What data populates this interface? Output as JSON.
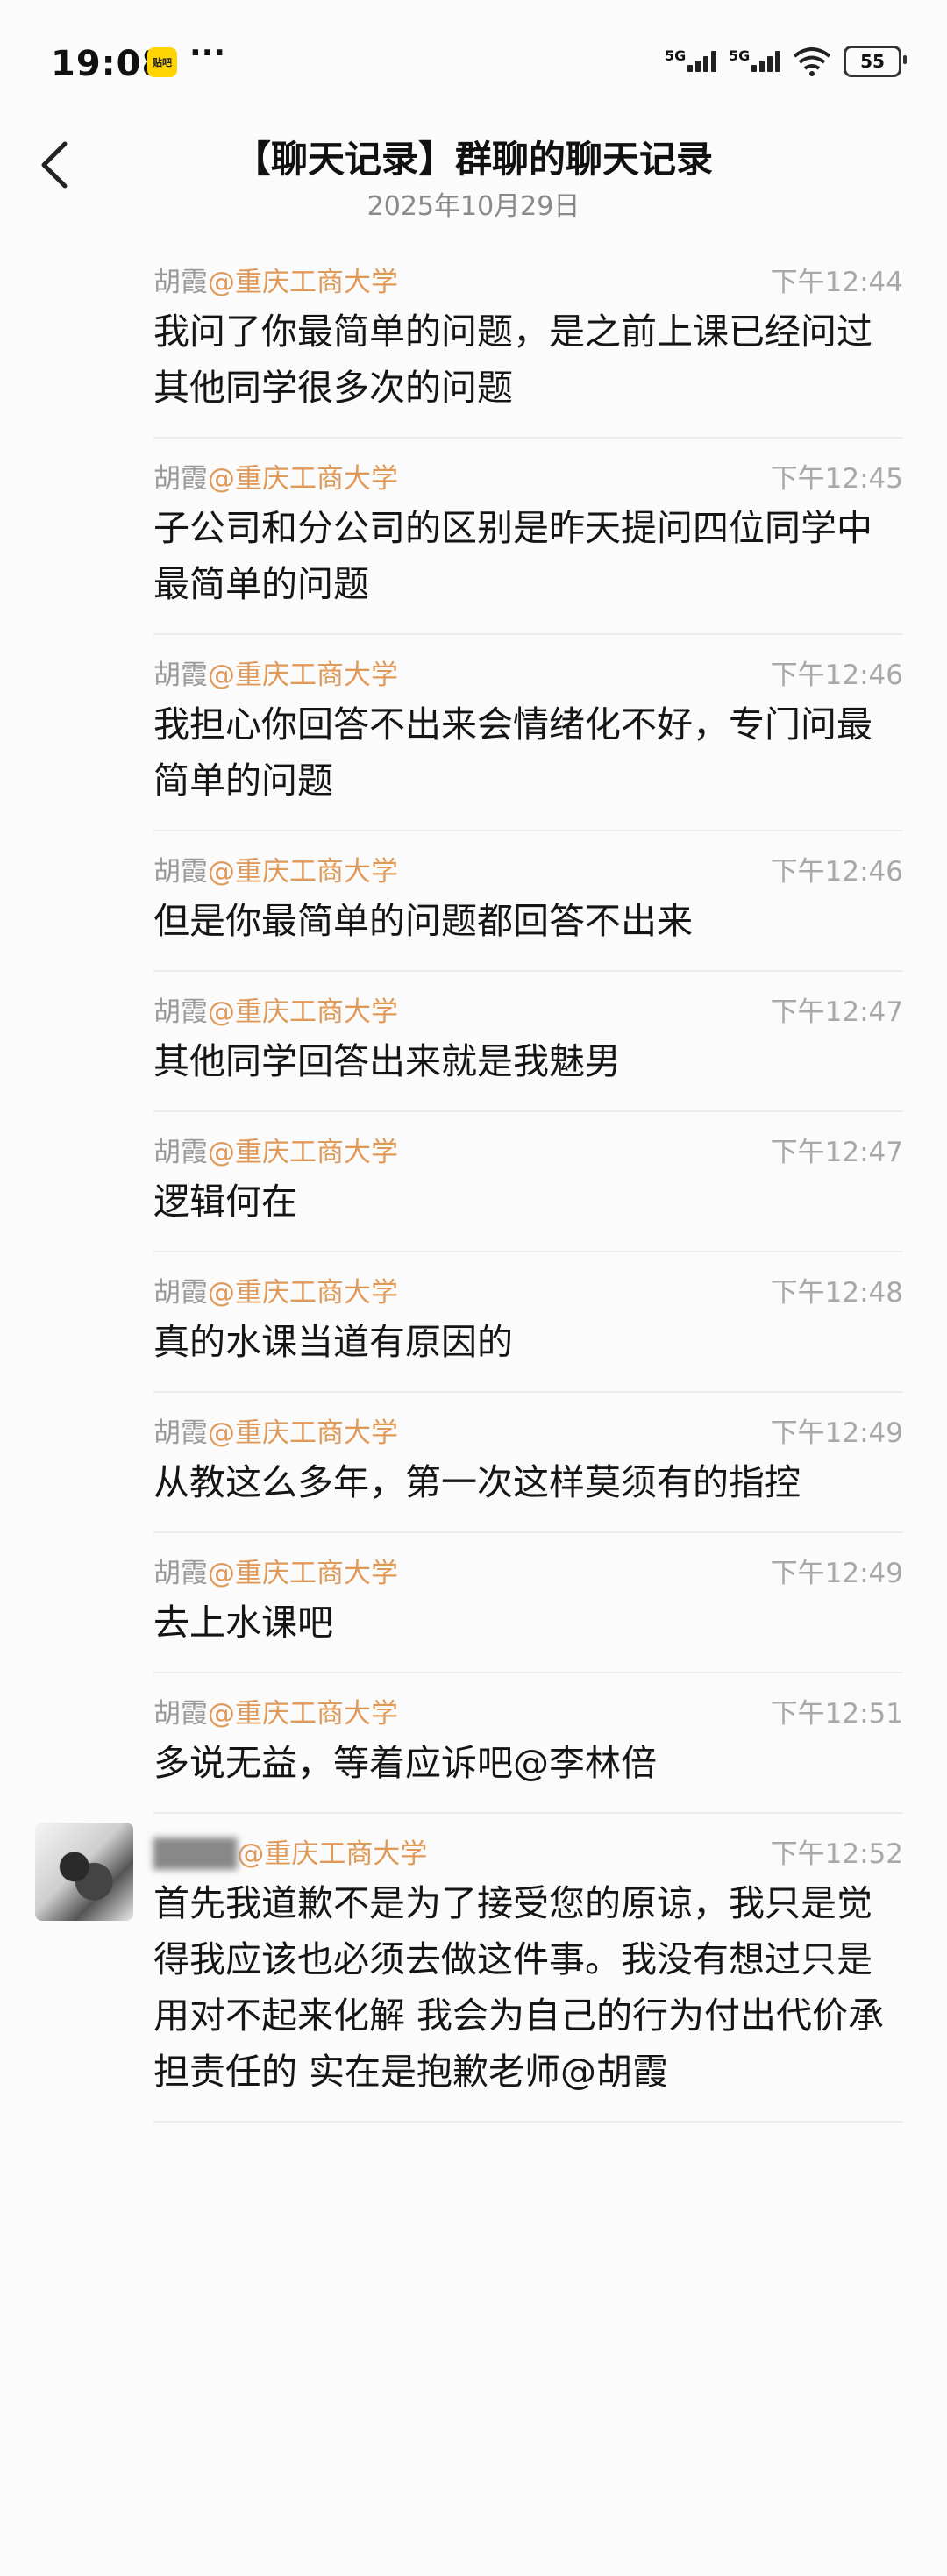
{
  "status": {
    "time": "19:08",
    "app_badge": "贴吧",
    "dots": "···",
    "net1": "5G",
    "net2": "5G",
    "battery": "55"
  },
  "header": {
    "title": "【聊天记录】群聊的聊天记录",
    "date": "2025年10月29日"
  },
  "messages": [
    {
      "name": "胡霞",
      "org": "@重庆工商大学",
      "time": "下午12:44",
      "text": "我问了你最简单的问题，是之前上课已经问过其他同学很多次的问题"
    },
    {
      "name": "胡霞",
      "org": "@重庆工商大学",
      "time": "下午12:45",
      "text": "子公司和分公司的区别是昨天提问四位同学中最简单的问题"
    },
    {
      "name": "胡霞",
      "org": "@重庆工商大学",
      "time": "下午12:46",
      "text": "我担心你回答不出来会情绪化不好，专门问最简单的问题"
    },
    {
      "name": "胡霞",
      "org": "@重庆工商大学",
      "time": "下午12:46",
      "text": "但是你最简单的问题都回答不出来"
    },
    {
      "name": "胡霞",
      "org": "@重庆工商大学",
      "time": "下午12:47",
      "text": "其他同学回答出来就是我魅男"
    },
    {
      "name": "胡霞",
      "org": "@重庆工商大学",
      "time": "下午12:47",
      "text": "逻辑何在"
    },
    {
      "name": "胡霞",
      "org": "@重庆工商大学",
      "time": "下午12:48",
      "text": "真的水课当道有原因的"
    },
    {
      "name": "胡霞",
      "org": "@重庆工商大学",
      "time": "下午12:49",
      "text": "从教这么多年，第一次这样莫须有的指控"
    },
    {
      "name": "胡霞",
      "org": "@重庆工商大学",
      "time": "下午12:49",
      "text": "去上水课吧"
    },
    {
      "name": "胡霞",
      "org": "@重庆工商大学",
      "time": "下午12:51",
      "text": "多说无益，等着应诉吧@李林倍"
    },
    {
      "name": "",
      "org": "@重庆工商大学",
      "time": "下午12:52",
      "text": "首先我道歉不是为了接受您的原谅，我只是觉得我应该也必须去做这件事。我没有想过只是用对不起来化解 我会为自己的行为付出代价承担责任的 实在是抱歉老师@胡霞"
    }
  ]
}
